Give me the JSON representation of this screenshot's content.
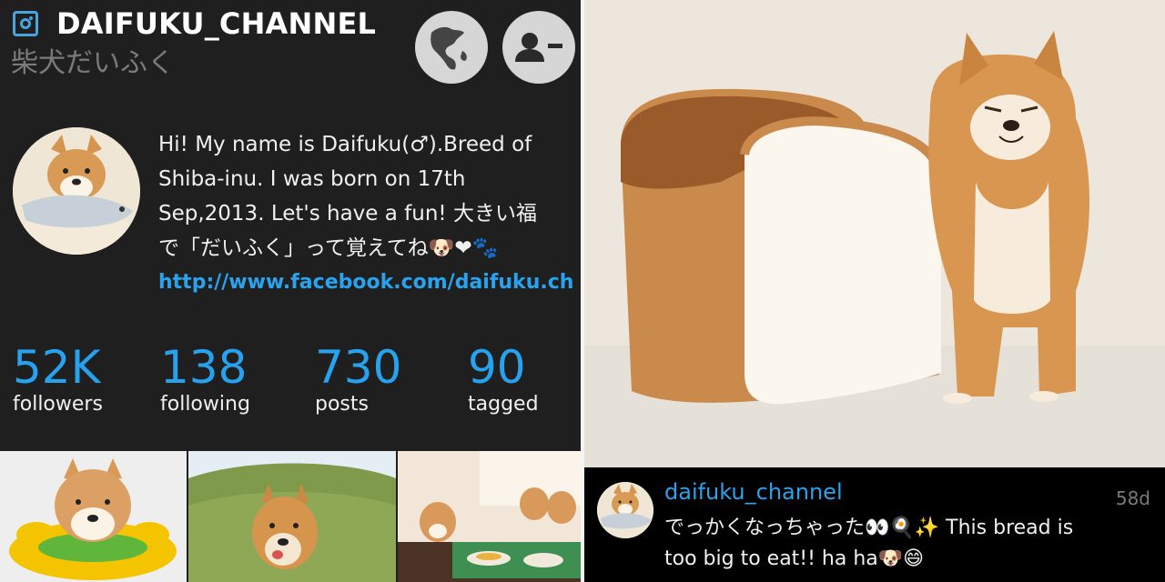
{
  "profile": {
    "username": "DAIFUKU_CHANNEL",
    "display_name": "柴犬だいふく",
    "bio": "Hi! My name is Daifuku(♂).Breed of\nShiba-inu. I was born on 17th\nSep,2013. Let's have a fun! 大きい福\nで「だいふく」って覚えてね🐶❤🐾",
    "website": "http://www.facebook.com/daifuku.ch"
  },
  "stats": [
    {
      "value": "52K",
      "label": "followers"
    },
    {
      "value": "138",
      "label": "following"
    },
    {
      "value": "730",
      "label": "posts"
    },
    {
      "value": "90",
      "label": "tagged"
    }
  ],
  "header_buttons": {
    "globe": "globe-icon",
    "unfollow": "user-minus-icon"
  },
  "post": {
    "username": "daifuku_channel",
    "time": "58d",
    "caption": "でっかくなっちゃった👀🍳✨ This bread is\ntoo big to eat!! ha ha🐶😄"
  },
  "colors": {
    "accent": "#26a2ee",
    "panel_bg": "#1f1f1f",
    "text": "#f0f0f0",
    "muted": "#7a7a7a"
  }
}
